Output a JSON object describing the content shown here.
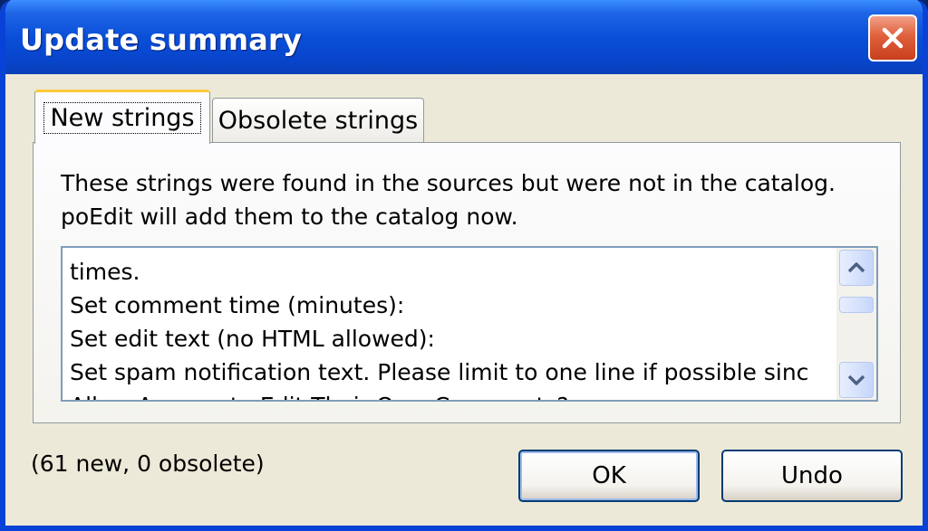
{
  "window": {
    "title": "Update summary"
  },
  "tabs": [
    {
      "label": "New strings",
      "active": true
    },
    {
      "label": "Obsolete strings",
      "active": false
    }
  ],
  "description": {
    "line1": "These strings were found in the sources but were not in the catalog.",
    "line2": "poEdit will add them to the catalog now."
  },
  "strings_list": [
    "times.",
    "Set comment time (minutes):",
    "Set edit text (no HTML allowed):",
    "Set spam notification text.  Please limit to one line if possible sinc",
    "Allow Anyone to Edit Their Own Comments?"
  ],
  "status": "(61 new, 0 obsolete)",
  "buttons": {
    "ok": "OK",
    "undo": "Undo"
  },
  "icons": {
    "close": "close-icon",
    "scroll_up": "chevron-up-icon",
    "scroll_down": "chevron-down-icon"
  },
  "colors": {
    "titlebar": "#0a4fd8",
    "window_bg": "#ece9d8",
    "close_button": "#e0603c",
    "active_tab_highlight": "#ffc83c"
  }
}
